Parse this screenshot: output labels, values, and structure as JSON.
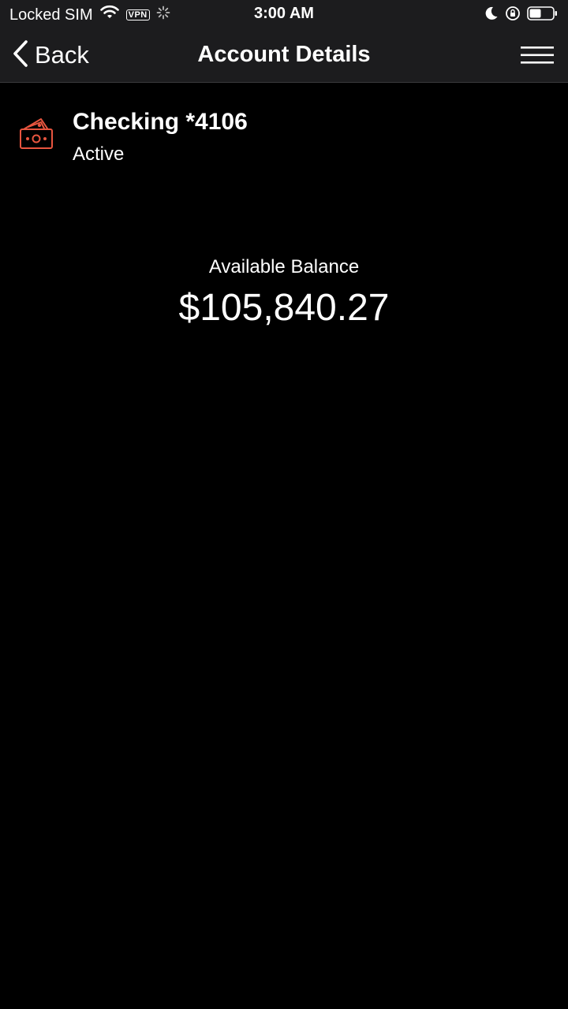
{
  "status_bar": {
    "carrier": "Locked SIM",
    "vpn": "VPN",
    "time": "3:00 AM",
    "icons": [
      "wifi-icon",
      "vpn-badge",
      "loading-spinner-icon",
      "moon-icon",
      "orientation-lock-icon",
      "battery-icon"
    ]
  },
  "nav": {
    "back_label": "Back",
    "title": "Account Details",
    "menu_icon": "hamburger-menu-icon"
  },
  "account": {
    "name": "Checking *4106",
    "status": "Active",
    "icon": "money-wallet-icon",
    "icon_color": "#e8553f"
  },
  "balance": {
    "label": "Available Balance",
    "amount": "$105,840.27"
  },
  "colors": {
    "background": "#000000",
    "bar_background": "#1c1c1e",
    "text": "#ffffff",
    "accent": "#e8553f"
  }
}
